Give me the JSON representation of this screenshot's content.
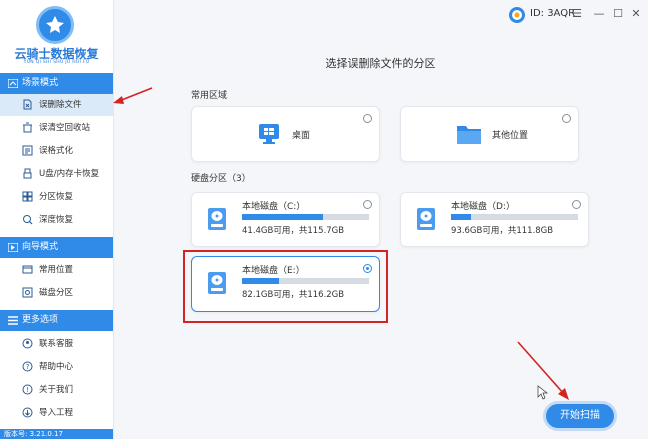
{
  "app": {
    "title": "云骑士数据恢复",
    "subtitle": "YUN QI SHI SHU JU HUI FU",
    "id_label": "ID: 3AQR",
    "version": "版本号: 3.21.0.17"
  },
  "window_controls": [
    "☰",
    "—",
    "☐",
    "✕"
  ],
  "sidebar": {
    "sections": [
      {
        "title": "场景模式",
        "items": [
          {
            "label": "误删除文件",
            "icon": "delete-file-icon",
            "active": true
          },
          {
            "label": "误清空回收站",
            "icon": "recycle-bin-icon"
          },
          {
            "label": "误格式化",
            "icon": "format-icon"
          },
          {
            "label": "U盘/内存卡恢复",
            "icon": "usb-icon"
          },
          {
            "label": "分区恢复",
            "icon": "partition-icon"
          },
          {
            "label": "深度恢复",
            "icon": "deep-scan-icon"
          }
        ]
      },
      {
        "title": "向导模式",
        "items": [
          {
            "label": "常用位置",
            "icon": "location-icon"
          },
          {
            "label": "磁盘分区",
            "icon": "disk-icon"
          }
        ]
      },
      {
        "title": "更多选项",
        "items": [
          {
            "label": "联系客服",
            "icon": "support-icon"
          },
          {
            "label": "帮助中心",
            "icon": "help-icon"
          },
          {
            "label": "关于我们",
            "icon": "info-icon"
          },
          {
            "label": "导入工程",
            "icon": "import-icon"
          }
        ]
      }
    ]
  },
  "main": {
    "title": "选择误删除文件的分区",
    "common_section": {
      "label": "常用区域",
      "cards": [
        {
          "label": "桌面",
          "icon": "desktop-icon"
        },
        {
          "label": "其他位置",
          "icon": "folder-icon"
        }
      ]
    },
    "disk_section": {
      "label": "硬盘分区（3）",
      "drives": [
        {
          "name": "本地磁盘（C:）",
          "info": "41.4GB可用，共115.7GB",
          "used_fraction": 0.64,
          "selected": false
        },
        {
          "name": "本地磁盘（D:）",
          "info": "93.6GB可用，共111.8GB",
          "used_fraction": 0.16,
          "selected": false
        },
        {
          "name": "本地磁盘（E:）",
          "info": "82.1GB可用，共116.2GB",
          "used_fraction": 0.29,
          "selected": true
        }
      ]
    },
    "scan_button": "开始扫描"
  },
  "colors": {
    "accent": "#2f8ae8",
    "annotation": "#d32424"
  }
}
